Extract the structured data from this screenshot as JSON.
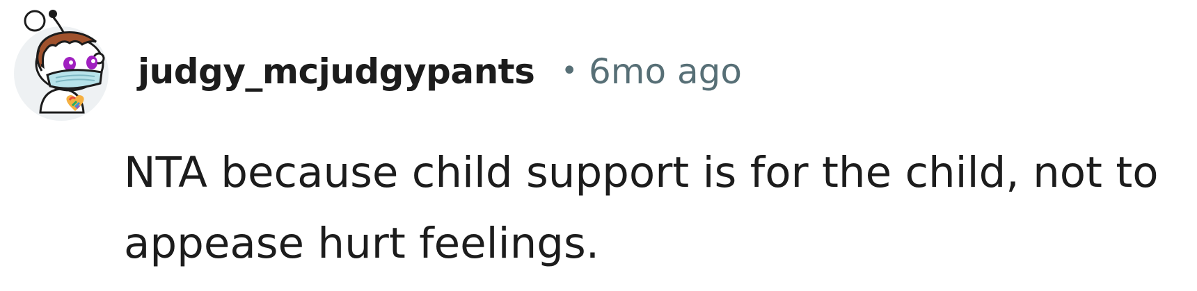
{
  "comment": {
    "author": "judgy_mcjudgypants",
    "separator": "•",
    "timestamp": "6mo ago",
    "body": "NTA because child support is for the child, not to appease hurt feelings.",
    "avatar_icon": "snoo-avatar-icon"
  },
  "colors": {
    "author_text": "#1c1c1c",
    "meta_text": "#576f76",
    "avatar_bg": "#eef1f3",
    "body_text": "#1c1c1c"
  }
}
